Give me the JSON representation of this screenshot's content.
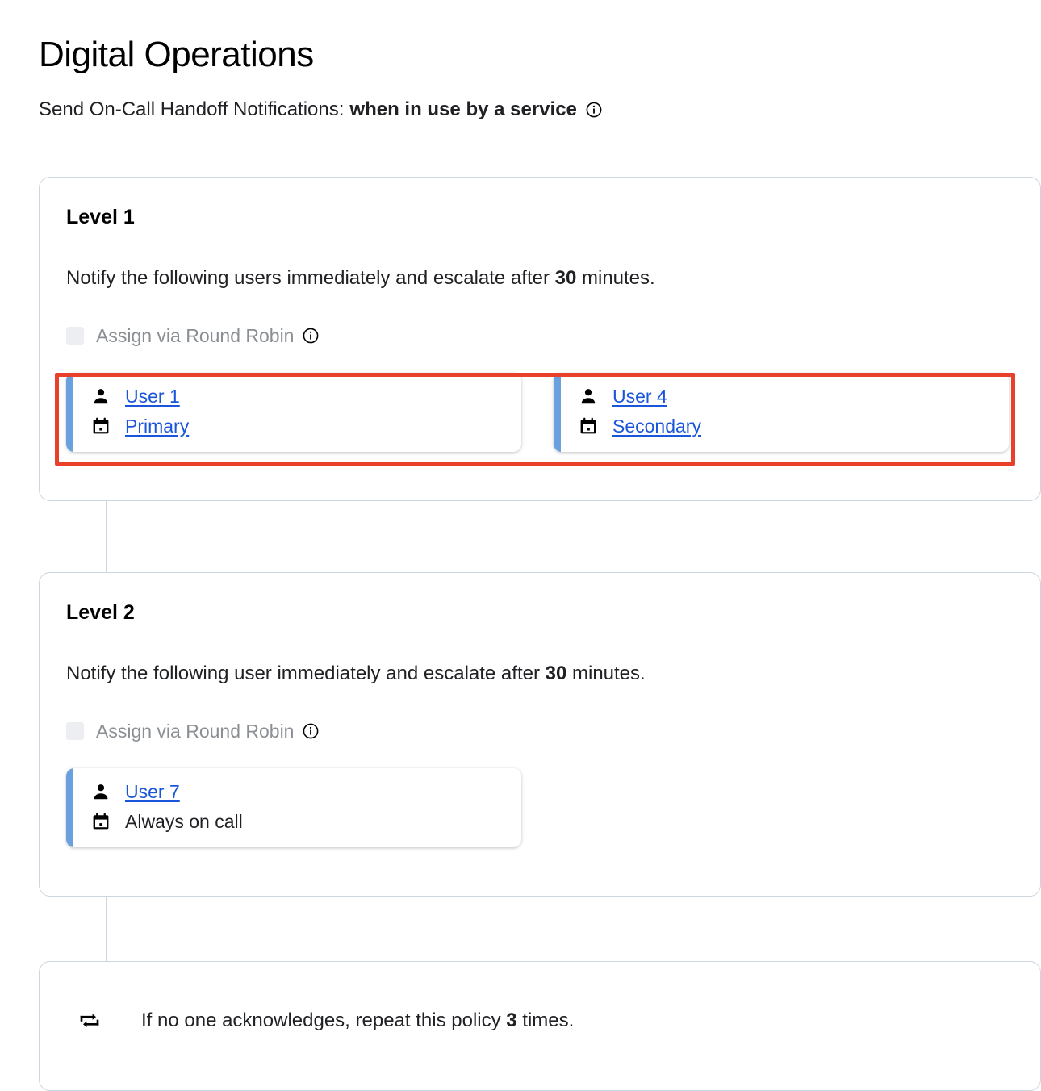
{
  "header": {
    "title": "Digital Operations",
    "handoff_label": "Send On-Call Handoff Notifications:",
    "handoff_value": "when in use by a service",
    "handoff_info_icon": "info-circle-icon"
  },
  "colors": {
    "link": "#1a56db",
    "accent_bar": "#6aa0dd",
    "highlight": "#e8402a",
    "card_border": "#ccd6e0",
    "connector": "#ccd6e0",
    "muted_text": "#8b8f94",
    "checkbox_disabled": "#eceef2"
  },
  "levels": [
    {
      "title": "Level 1",
      "description_prefix": "Notify the following users immediately and escalate after ",
      "description_value": "30",
      "description_suffix": " minutes.",
      "round_robin": {
        "label": "Assign via Round Robin",
        "checked": false,
        "info_icon": "info-circle-icon"
      },
      "assignees": [
        {
          "user_icon": "person-icon",
          "user_name": "User 1",
          "user_is_link": true,
          "schedule_icon": "calendar-icon",
          "schedule_name": "Primary",
          "schedule_is_link": true
        },
        {
          "user_icon": "person-icon",
          "user_name": "User 4",
          "user_is_link": true,
          "schedule_icon": "calendar-icon",
          "schedule_name": "Secondary",
          "schedule_is_link": true
        }
      ]
    },
    {
      "title": "Level 2",
      "description_prefix": "Notify the following user immediately and escalate after ",
      "description_value": "30",
      "description_suffix": " minutes.",
      "round_robin": {
        "label": "Assign via Round Robin",
        "checked": false,
        "info_icon": "info-circle-icon"
      },
      "assignees": [
        {
          "user_icon": "person-icon",
          "user_name": "User 7",
          "user_is_link": true,
          "schedule_icon": "calendar-icon",
          "schedule_name": "Always on call",
          "schedule_is_link": false
        }
      ]
    }
  ],
  "repeat_policy": {
    "icon": "repeat-icon",
    "prefix": "If no one acknowledges, repeat this policy ",
    "count": "3",
    "suffix": " times."
  }
}
